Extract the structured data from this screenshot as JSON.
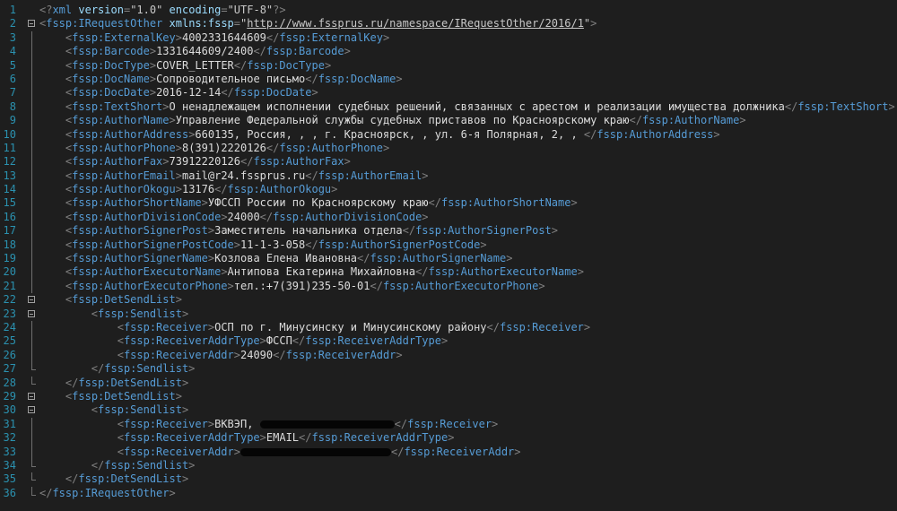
{
  "editor": {
    "lines": [
      {
        "n": "1",
        "fold": "none",
        "html": "<span class='br'>&lt;?</span><span class='tn'>xml</span> <span class='at'>version</span><span class='br'>=</span><span class='av'>\"1.0\"</span> <span class='at'>encoding</span><span class='br'>=</span><span class='av'>\"UTF-8\"</span><span class='br'>?&gt;</span>"
      },
      {
        "n": "2",
        "fold": "box",
        "html": "<span class='br'>&lt;</span><span class='tn'>fssp:IRequestOther</span> <span class='at'>xmlns:fssp</span><span class='br'>=</span><span class='av'>\"</span><span class='url'>http://www.fssprus.ru/namespace/IRequestOther/2016/1</span><span class='av'>\"</span><span class='br'>&gt;</span>"
      },
      {
        "n": "3",
        "fold": "vline",
        "html": "    <span class='br'>&lt;</span><span class='tn'>fssp:ExternalKey</span><span class='br'>&gt;</span><span class='tx'>4002331644609</span><span class='br'>&lt;/</span><span class='tn'>fssp:ExternalKey</span><span class='br'>&gt;</span>"
      },
      {
        "n": "4",
        "fold": "vline",
        "html": "    <span class='br'>&lt;</span><span class='tn'>fssp:Barcode</span><span class='br'>&gt;</span><span class='tx'>1331644609/2400</span><span class='br'>&lt;/</span><span class='tn'>fssp:Barcode</span><span class='br'>&gt;</span>"
      },
      {
        "n": "5",
        "fold": "vline",
        "html": "    <span class='br'>&lt;</span><span class='tn'>fssp:DocType</span><span class='br'>&gt;</span><span class='tx'>COVER_LETTER</span><span class='br'>&lt;/</span><span class='tn'>fssp:DocType</span><span class='br'>&gt;</span>"
      },
      {
        "n": "6",
        "fold": "vline",
        "html": "    <span class='br'>&lt;</span><span class='tn'>fssp:DocName</span><span class='br'>&gt;</span><span class='tx'>Сопроводительное письмо</span><span class='br'>&lt;/</span><span class='tn'>fssp:DocName</span><span class='br'>&gt;</span>"
      },
      {
        "n": "7",
        "fold": "vline",
        "html": "    <span class='br'>&lt;</span><span class='tn'>fssp:DocDate</span><span class='br'>&gt;</span><span class='tx'>2016-12-14</span><span class='br'>&lt;/</span><span class='tn'>fssp:DocDate</span><span class='br'>&gt;</span>"
      },
      {
        "n": "8",
        "fold": "vline",
        "html": "    <span class='br'>&lt;</span><span class='tn'>fssp:TextShort</span><span class='br'>&gt;</span><span class='tx'>О ненадлежащем исполнении судебных решений, связанных с арестом и реализации имущества должника</span><span class='br'>&lt;/</span><span class='tn'>fssp:TextShort</span><span class='br'>&gt;</span>"
      },
      {
        "n": "9",
        "fold": "vline",
        "html": "    <span class='br'>&lt;</span><span class='tn'>fssp:AuthorName</span><span class='br'>&gt;</span><span class='tx'>Управление Федеральной службы судебных приставов по Красноярскому краю</span><span class='br'>&lt;/</span><span class='tn'>fssp:AuthorName</span><span class='br'>&gt;</span>"
      },
      {
        "n": "10",
        "fold": "vline",
        "html": "    <span class='br'>&lt;</span><span class='tn'>fssp:AuthorAddress</span><span class='br'>&gt;</span><span class='tx'>660135, Россия, , , г. Красноярск, , ул. 6-я Полярная, 2, , </span><span class='br'>&lt;/</span><span class='tn'>fssp:AuthorAddress</span><span class='br'>&gt;</span>"
      },
      {
        "n": "11",
        "fold": "vline",
        "html": "    <span class='br'>&lt;</span><span class='tn'>fssp:AuthorPhone</span><span class='br'>&gt;</span><span class='tx'>8(391)2220126</span><span class='br'>&lt;/</span><span class='tn'>fssp:AuthorPhone</span><span class='br'>&gt;</span>"
      },
      {
        "n": "12",
        "fold": "vline",
        "html": "    <span class='br'>&lt;</span><span class='tn'>fssp:AuthorFax</span><span class='br'>&gt;</span><span class='tx'>73912220126</span><span class='br'>&lt;/</span><span class='tn'>fssp:AuthorFax</span><span class='br'>&gt;</span>"
      },
      {
        "n": "13",
        "fold": "vline",
        "html": "    <span class='br'>&lt;</span><span class='tn'>fssp:AuthorEmail</span><span class='br'>&gt;</span><span class='tx'>mail@r24.fssprus.ru</span><span class='br'>&lt;/</span><span class='tn'>fssp:AuthorEmail</span><span class='br'>&gt;</span>"
      },
      {
        "n": "14",
        "fold": "vline",
        "html": "    <span class='br'>&lt;</span><span class='tn'>fssp:AuthorOkogu</span><span class='br'>&gt;</span><span class='tx'>13176</span><span class='br'>&lt;/</span><span class='tn'>fssp:AuthorOkogu</span><span class='br'>&gt;</span>"
      },
      {
        "n": "15",
        "fold": "vline",
        "html": "    <span class='br'>&lt;</span><span class='tn'>fssp:AuthorShortName</span><span class='br'>&gt;</span><span class='tx'>УФССП России по Красноярскому краю</span><span class='br'>&lt;/</span><span class='tn'>fssp:AuthorShortName</span><span class='br'>&gt;</span>"
      },
      {
        "n": "16",
        "fold": "vline",
        "html": "    <span class='br'>&lt;</span><span class='tn'>fssp:AuthorDivisionCode</span><span class='br'>&gt;</span><span class='tx'>24000</span><span class='br'>&lt;/</span><span class='tn'>fssp:AuthorDivisionCode</span><span class='br'>&gt;</span>"
      },
      {
        "n": "17",
        "fold": "vline",
        "html": "    <span class='br'>&lt;</span><span class='tn'>fssp:AuthorSignerPost</span><span class='br'>&gt;</span><span class='tx'>Заместитель начальника отдела</span><span class='br'>&lt;/</span><span class='tn'>fssp:AuthorSignerPost</span><span class='br'>&gt;</span>"
      },
      {
        "n": "18",
        "fold": "vline",
        "html": "    <span class='br'>&lt;</span><span class='tn'>fssp:AuthorSignerPostCode</span><span class='br'>&gt;</span><span class='tx'>11-1-3-058</span><span class='br'>&lt;/</span><span class='tn'>fssp:AuthorSignerPostCode</span><span class='br'>&gt;</span>"
      },
      {
        "n": "19",
        "fold": "vline",
        "html": "    <span class='br'>&lt;</span><span class='tn'>fssp:AuthorSignerName</span><span class='br'>&gt;</span><span class='tx'>Козлова Елена Ивановна</span><span class='br'>&lt;/</span><span class='tn'>fssp:AuthorSignerName</span><span class='br'>&gt;</span>"
      },
      {
        "n": "20",
        "fold": "vline",
        "html": "    <span class='br'>&lt;</span><span class='tn'>fssp:AuthorExecutorName</span><span class='br'>&gt;</span><span class='tx'>Антипова Екатерина Михайловна</span><span class='br'>&lt;/</span><span class='tn'>fssp:AuthorExecutorName</span><span class='br'>&gt;</span>"
      },
      {
        "n": "21",
        "fold": "vline",
        "html": "    <span class='br'>&lt;</span><span class='tn'>fssp:AuthorExecutorPhone</span><span class='br'>&gt;</span><span class='tx'>тел.:+7(391)235-50-01</span><span class='br'>&lt;/</span><span class='tn'>fssp:AuthorExecutorPhone</span><span class='br'>&gt;</span>"
      },
      {
        "n": "22",
        "fold": "box",
        "html": "    <span class='br'>&lt;</span><span class='tn'>fssp:DetSendList</span><span class='br'>&gt;</span>"
      },
      {
        "n": "23",
        "fold": "box",
        "html": "        <span class='br'>&lt;</span><span class='tn'>fssp:Sendlist</span><span class='br'>&gt;</span>"
      },
      {
        "n": "24",
        "fold": "vline",
        "html": "            <span class='br'>&lt;</span><span class='tn'>fssp:Receiver</span><span class='br'>&gt;</span><span class='tx'>ОСП по г. Минусинску и Минусинскому району</span><span class='br'>&lt;/</span><span class='tn'>fssp:Receiver</span><span class='br'>&gt;</span>"
      },
      {
        "n": "25",
        "fold": "vline",
        "html": "            <span class='br'>&lt;</span><span class='tn'>fssp:ReceiverAddrType</span><span class='br'>&gt;</span><span class='tx'>ФССП</span><span class='br'>&lt;/</span><span class='tn'>fssp:ReceiverAddrType</span><span class='br'>&gt;</span>"
      },
      {
        "n": "26",
        "fold": "vline",
        "html": "            <span class='br'>&lt;</span><span class='tn'>fssp:ReceiverAddr</span><span class='br'>&gt;</span><span class='tx'>24090</span><span class='br'>&lt;/</span><span class='tn'>fssp:ReceiverAddr</span><span class='br'>&gt;</span>"
      },
      {
        "n": "27",
        "fold": "tick",
        "html": "        <span class='br'>&lt;/</span><span class='tn'>fssp:Sendlist</span><span class='br'>&gt;</span>"
      },
      {
        "n": "28",
        "fold": "tick",
        "html": "    <span class='br'>&lt;/</span><span class='tn'>fssp:DetSendList</span><span class='br'>&gt;</span>"
      },
      {
        "n": "29",
        "fold": "box",
        "html": "    <span class='br'>&lt;</span><span class='tn'>fssp:DetSendList</span><span class='br'>&gt;</span>"
      },
      {
        "n": "30",
        "fold": "box",
        "html": "        <span class='br'>&lt;</span><span class='tn'>fssp:Sendlist</span><span class='br'>&gt;</span>"
      },
      {
        "n": "31",
        "fold": "vline",
        "html": "            <span class='br'>&lt;</span><span class='tn'>fssp:Receiver</span><span class='br'>&gt;</span><span class='tx'>ВКВЭП, </span><span class='redact' style='width:150px'></span><span class='br'>&lt;/</span><span class='tn'>fssp:Receiver</span><span class='br'>&gt;</span>"
      },
      {
        "n": "32",
        "fold": "vline",
        "html": "            <span class='br'>&lt;</span><span class='tn'>fssp:ReceiverAddrType</span><span class='br'>&gt;</span><span class='tx'>EMAIL</span><span class='br'>&lt;/</span><span class='tn'>fssp:ReceiverAddrType</span><span class='br'>&gt;</span>"
      },
      {
        "n": "33",
        "fold": "vline",
        "html": "            <span class='br'>&lt;</span><span class='tn'>fssp:ReceiverAddr</span><span class='br'>&gt;</span><span class='redact' style='width:168px'></span><span class='br'>&lt;/</span><span class='tn'>fssp:ReceiverAddr</span><span class='br'>&gt;</span>"
      },
      {
        "n": "34",
        "fold": "tick",
        "html": "        <span class='br'>&lt;/</span><span class='tn'>fssp:Sendlist</span><span class='br'>&gt;</span>"
      },
      {
        "n": "35",
        "fold": "tick",
        "html": "    <span class='br'>&lt;/</span><span class='tn'>fssp:DetSendList</span><span class='br'>&gt;</span>"
      },
      {
        "n": "36",
        "fold": "end",
        "html": "<span class='br'>&lt;/</span><span class='tn'>fssp:IRequestOther</span><span class='br'>&gt;</span>"
      }
    ]
  }
}
